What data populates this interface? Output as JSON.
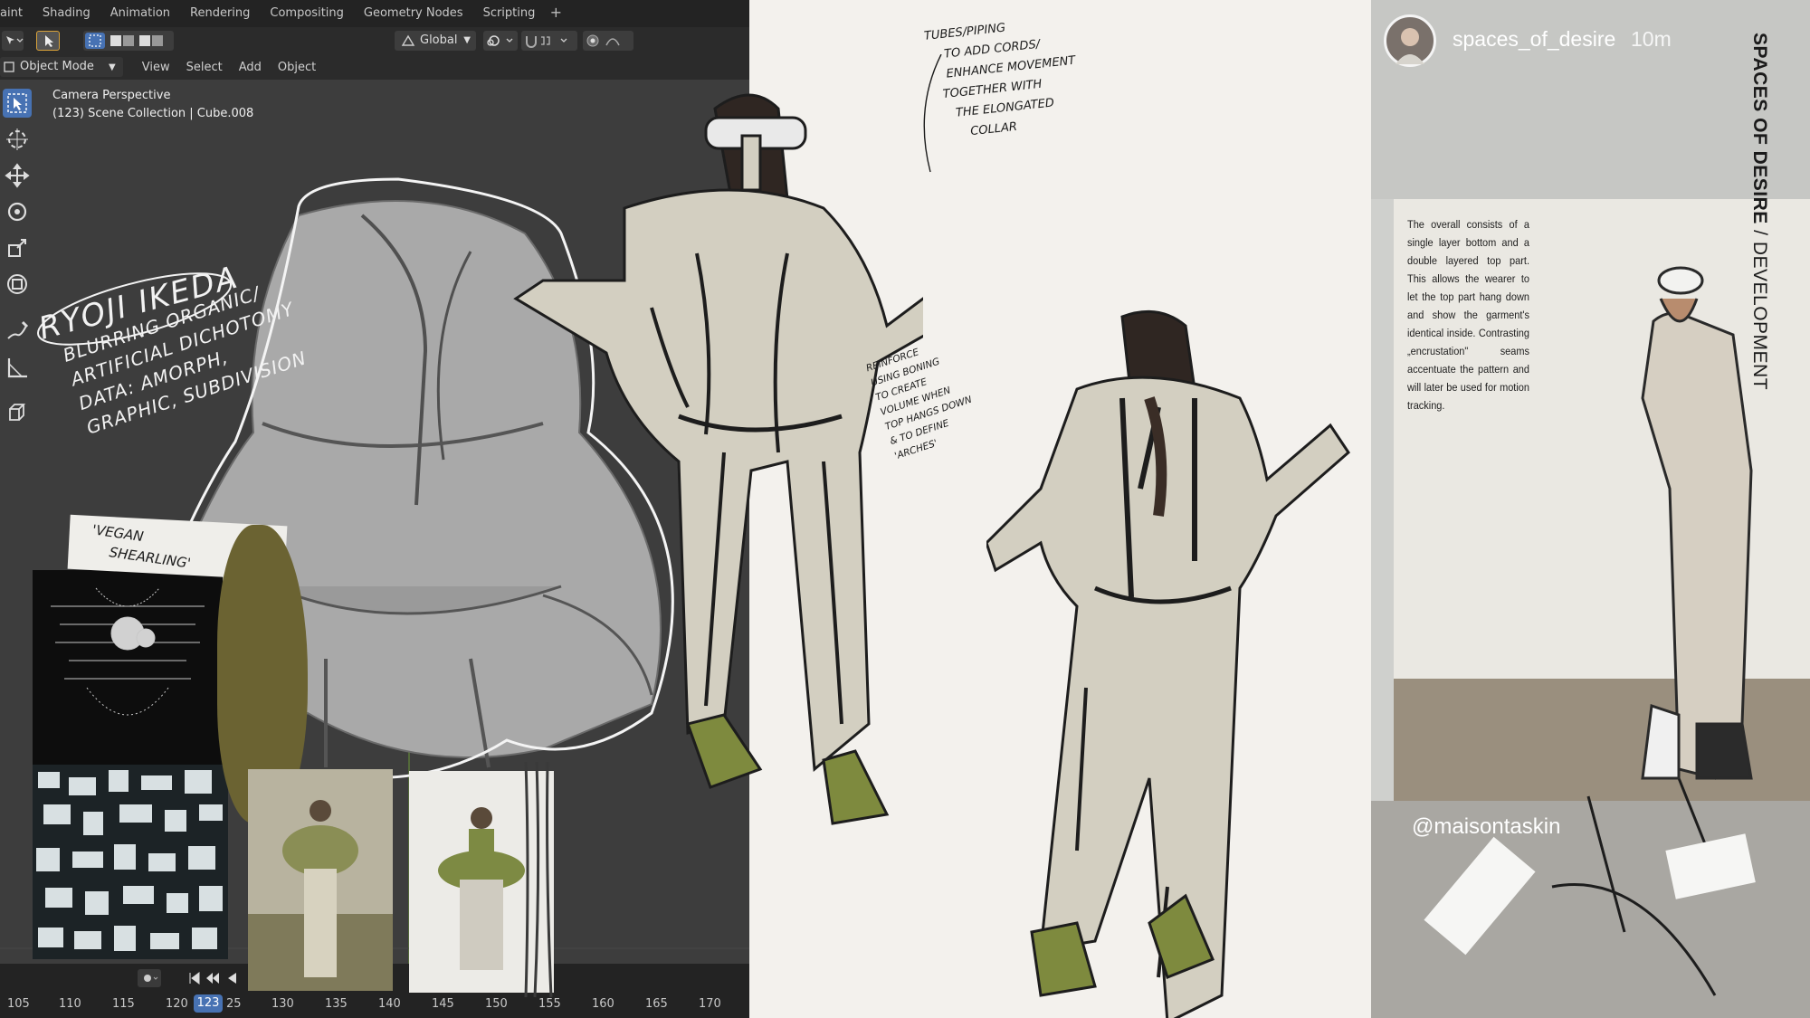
{
  "blender": {
    "workspace_tabs": [
      "aint",
      "Shading",
      "Animation",
      "Rendering",
      "Compositing",
      "Geometry Nodes",
      "Scripting"
    ],
    "add_workspace": "+",
    "transform_orientation": "Global",
    "mode": "Object Mode",
    "menus": [
      "View",
      "Select",
      "Add",
      "Object"
    ],
    "viewport_overlay": {
      "view_name": "Camera Perspective",
      "collection_info": "(123) Scene Collection | Cube.008"
    },
    "timeline": {
      "frames": [
        "105",
        "110",
        "115",
        "120",
        "25",
        "130",
        "135",
        "140",
        "145",
        "150",
        "155",
        "160",
        "165",
        "170"
      ],
      "current_frame": "123"
    }
  },
  "collage": {
    "annotation_ryoji": "RYOJI IKEDA",
    "annotation_blurring": [
      "BLURRING ORGANIC/",
      "ARTIFICIAL DICHOTOMY",
      "DATA: AMORPH,",
      "GRAPHIC, SUBDIVISION"
    ],
    "annotation_vegan": [
      "'VEGAN",
      "SHEARLING'"
    ],
    "annotation_tubes": [
      "TUBES/PIPING",
      "TO ADD CORDS/",
      "ENHANCE MOVEMENT",
      "TOGETHER WITH",
      "THE ELONGATED",
      "COLLAR"
    ],
    "annotation_reinforce": [
      "REINFORCE",
      "USING BONING",
      "TO CREATE",
      "VOLUME WHEN",
      "TOP HANGS DOWN",
      "& TO DEFINE",
      "'ARCHES'"
    ]
  },
  "instagram": {
    "username": "spaces_of_desire",
    "time_ago": "10m",
    "tag": "@maisontaskin"
  },
  "page": {
    "title_bold": "SPACES OF DESIRE",
    "title_rest": " / DEVELOPMENT",
    "description": "The overall consists of a single layer bottom and a double layered top part. This allows the wearer to let the top part hang down and show the garment's identical inside. Contrasting „encrustation\" seams accentuate the pattern and will later be used for motion tracking."
  },
  "colors": {
    "blender_active": "#4772b3",
    "blender_bg": "#3d3d3d",
    "garment": "#d4d1c5",
    "shoe": "#7e8a3e"
  }
}
